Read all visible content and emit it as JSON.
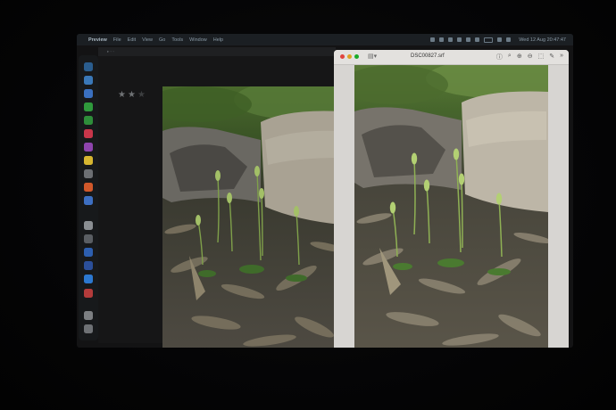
{
  "menubar": {
    "apple": "",
    "app_name": "Preview",
    "items": [
      "File",
      "Edit",
      "View",
      "Go",
      "Tools",
      "Window",
      "Help"
    ],
    "clock": "Wed 12 Aug  20:47:47"
  },
  "rating": {
    "stars": [
      "★",
      "★",
      "★"
    ]
  },
  "window_right": {
    "filename": "DSC00827.srf",
    "sidebar_icon": "▤▾",
    "tools": [
      "ⓘ",
      "⌕",
      "⊕",
      "⊖",
      "⬚",
      "✎",
      "»"
    ]
  },
  "dock_icon_names": [
    "finder-icon",
    "safari-icon",
    "mail-icon",
    "messages-icon",
    "facetime-icon",
    "music-icon",
    "podcasts-icon",
    "notes-icon",
    "settings-icon",
    "firefox-icon",
    "chrome-icon",
    "photos-icon",
    "launchpad-icon",
    "facebook-icon",
    "word-icon",
    "zoom-icon",
    "trash-icon"
  ]
}
